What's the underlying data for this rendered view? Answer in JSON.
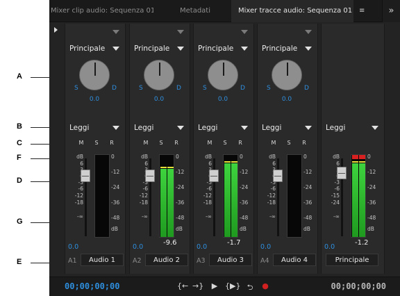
{
  "tabs": [
    {
      "label": "Mixer clip audio: Sequenza 01",
      "active": false
    },
    {
      "label": "Metadati",
      "active": false
    },
    {
      "label": "Mixer tracce audio: Sequenza 01",
      "active": true
    }
  ],
  "tab_menu_icon": "≡",
  "overflow_icon": "»",
  "callouts": [
    "A",
    "B",
    "C",
    "F",
    "D",
    "G",
    "E"
  ],
  "channels": [
    {
      "effects": "",
      "output": "Principale",
      "automation": "Leggi",
      "pan_left": "S",
      "pan_right": "D",
      "pan_value": "0.0",
      "mute": "M",
      "solo": "S",
      "record": "R",
      "fader_value": "0.0",
      "peak_value": "",
      "track_number": "A1",
      "track_name": "Audio 1",
      "meter_left": 0,
      "meter_right": 0
    },
    {
      "effects": "",
      "output": "Principale",
      "automation": "Leggi",
      "pan_left": "S",
      "pan_right": "D",
      "pan_value": "0.0",
      "mute": "M",
      "solo": "S",
      "record": "R",
      "fader_value": "0.0",
      "peak_value": "-9.6",
      "track_number": "A2",
      "track_name": "Audio 2",
      "meter_left": 0.83,
      "meter_right": 0.83
    },
    {
      "effects": "",
      "output": "Principale",
      "automation": "Leggi",
      "pan_left": "S",
      "pan_right": "D",
      "pan_value": "0.0",
      "mute": "M",
      "solo": "S",
      "record": "R",
      "fader_value": "0.0",
      "peak_value": "-1.7",
      "track_number": "A3",
      "track_name": "Audio 3",
      "meter_left": 0.9,
      "meter_right": 0.9
    },
    {
      "effects": "",
      "output": "Principale",
      "automation": "Leggi",
      "pan_left": "S",
      "pan_right": "D",
      "pan_value": "0.0",
      "mute": "M",
      "solo": "S",
      "record": "R",
      "fader_value": "0.0",
      "peak_value": "",
      "track_number": "A4",
      "track_name": "Audio 4",
      "meter_left": 0,
      "meter_right": 0
    }
  ],
  "master": {
    "automation": "Leggi",
    "fader_value": "0.0",
    "peak_value": "-1.2",
    "track_name": "Principale",
    "meter_left": 0.9,
    "meter_right": 0.9,
    "clip": true
  },
  "fader_scale": [
    "dB",
    "6",
    "3",
    "0",
    "-3",
    "-6",
    "-12",
    "-18",
    "-∞"
  ],
  "master_fader_scale": [
    "dB",
    "6",
    "3",
    "0",
    "-3",
    "-6",
    "-15",
    "-24",
    "-∞"
  ],
  "meter_scale": [
    "0",
    "-12",
    "-24",
    "-36",
    "-48",
    "dB"
  ],
  "timecode_current": "00;00;00;00",
  "timecode_duration": "00;00;00;00",
  "transport": {
    "go_in": "{←",
    "go_out": "→}",
    "play": "▶",
    "play_in_out": "{▶}",
    "loop": "⮌",
    "record": "●"
  },
  "colors": {
    "accent": "#2e8ede",
    "meter_green": "#3ed33e",
    "clip_red": "#d92020",
    "record_red": "#d02020"
  }
}
